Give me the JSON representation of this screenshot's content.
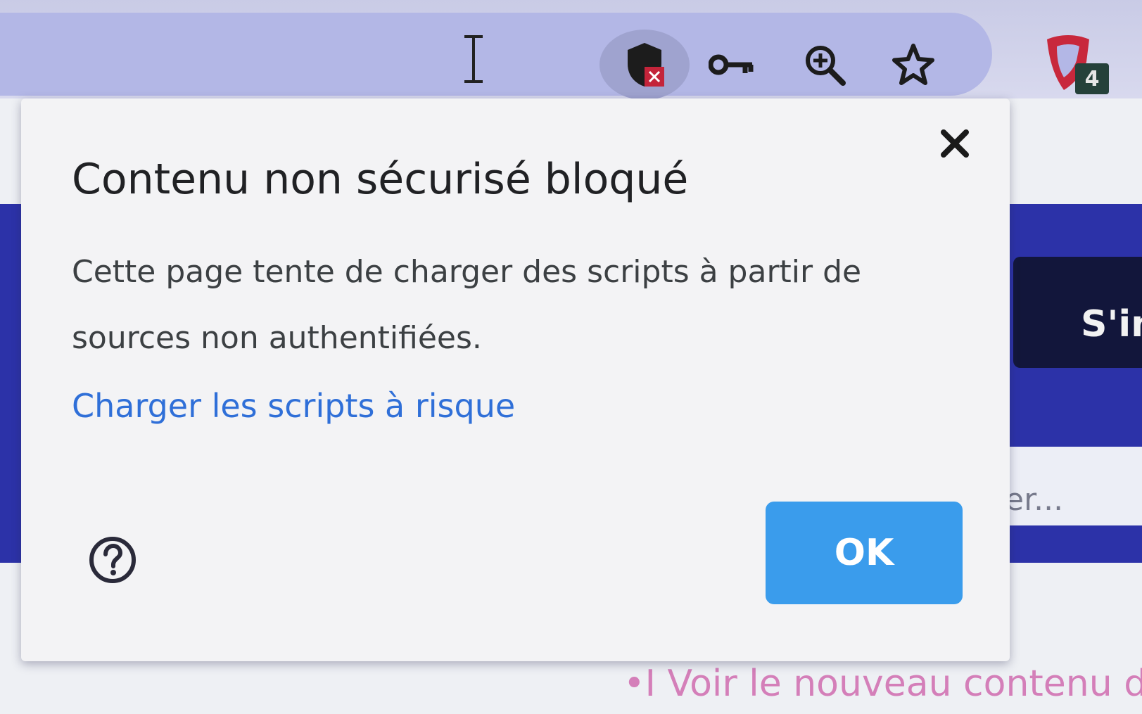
{
  "toolbar": {
    "icons": {
      "text_cursor": "text-cursor-icon",
      "insecure_content": "shield-blocked-icon",
      "password": "key-icon",
      "zoom": "zoom-in-icon",
      "bookmark": "star-icon",
      "extension": "extension-shield-icon"
    },
    "extension_badge": "4"
  },
  "page": {
    "signin_text": "S'in",
    "search_text": "er...",
    "new_content_link": "•I Voir le nouveau contenu d"
  },
  "dialog": {
    "title": "Contenu non sécurisé bloqué",
    "message": "Cette page tente de charger des scripts à partir de sources non authentifiées.",
    "link_label": "Charger les scripts à risque",
    "ok_label": "OK",
    "icons": {
      "close": "close-icon",
      "help": "help-icon"
    }
  },
  "colors": {
    "accent": "#3a9cec",
    "link": "#2f6fd8",
    "page_band": "#2c32a8",
    "blocked_badge": "#c4243a",
    "extension_red": "#c8283c"
  }
}
